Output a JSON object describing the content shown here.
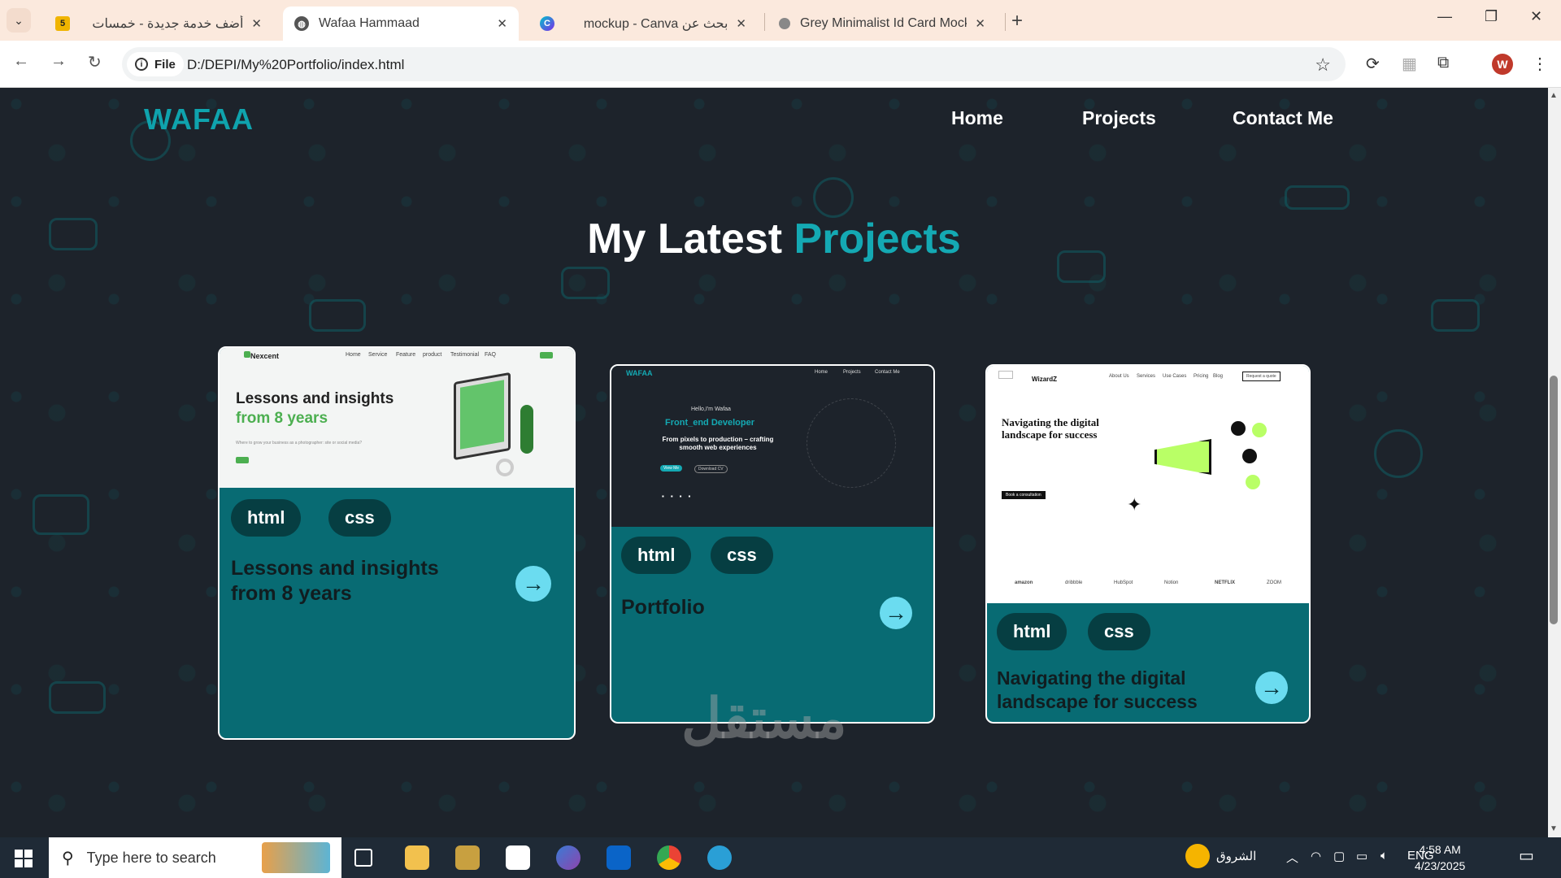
{
  "browser": {
    "tabs": [
      {
        "title": "أضف خدمة جديدة - خمسات",
        "favicon": "khamsat-icon",
        "active": false
      },
      {
        "title": "Wafaa Hammaad",
        "favicon": "globe-icon",
        "active": true
      },
      {
        "title": "mockup - Canva بحث عن",
        "favicon": "canva-icon",
        "active": false
      },
      {
        "title": "Grey Minimalist Id Card Mockup",
        "favicon": "page-icon",
        "active": false
      }
    ],
    "address": {
      "scheme_label": "File",
      "url": "D:/DEPI/My%20Portfolio/index.html"
    },
    "profile_initial": "W"
  },
  "site": {
    "logo": "WAFAA",
    "nav": [
      "Home",
      "Projects",
      "Contact Me"
    ],
    "section_title_main": "My Latest",
    "section_title_accent": "Projects",
    "projects": [
      {
        "tags": [
          "html",
          "css"
        ],
        "title": "Lessons and insights from 8 years",
        "thumb": {
          "brand": "Nexcent",
          "menu": [
            "Home",
            "Service",
            "Feature",
            "product",
            "Testimonial",
            "FAQ"
          ],
          "heading": "Lessons and insights",
          "heading_accent": "from 8 years",
          "sub": "Where to grow your business as a photographer: site or social media?"
        }
      },
      {
        "tags": [
          "html",
          "css"
        ],
        "title": "Portfolio",
        "thumb": {
          "brand": "WAFAA",
          "menu": [
            "Home",
            "Projects",
            "Contact Me"
          ],
          "hello": "Hello,I'm Wafaa",
          "role": "Front_end Developer",
          "tagline": "From pixels to production – crafting smooth web experiences",
          "btn1": "View Me",
          "btn2": "Download CV"
        }
      },
      {
        "tags": [
          "html",
          "css"
        ],
        "title": "Navigating the digital landscape for success",
        "thumb": {
          "brand": "WizardZ",
          "menu": [
            "About Us",
            "Services",
            "Use Cases",
            "Pricing",
            "Blog"
          ],
          "cta": "Request a quote",
          "heading": "Navigating the digital landscape for success",
          "button": "Book a consultation",
          "logos": [
            "amazon",
            "dribbble",
            "HubSpot",
            "Notion",
            "NETFLIX",
            "ZOOM"
          ]
        }
      }
    ]
  },
  "watermark": "مستقل",
  "taskbar": {
    "search_placeholder": "Type here to search",
    "weather": "الشروق",
    "lang": "ENG",
    "time": "4:58 AM",
    "date": "4/23/2025"
  },
  "colors": {
    "accent": "#14a9b3",
    "card": "#086b73",
    "tag": "#063e42",
    "page_bg": "#1d232b"
  }
}
